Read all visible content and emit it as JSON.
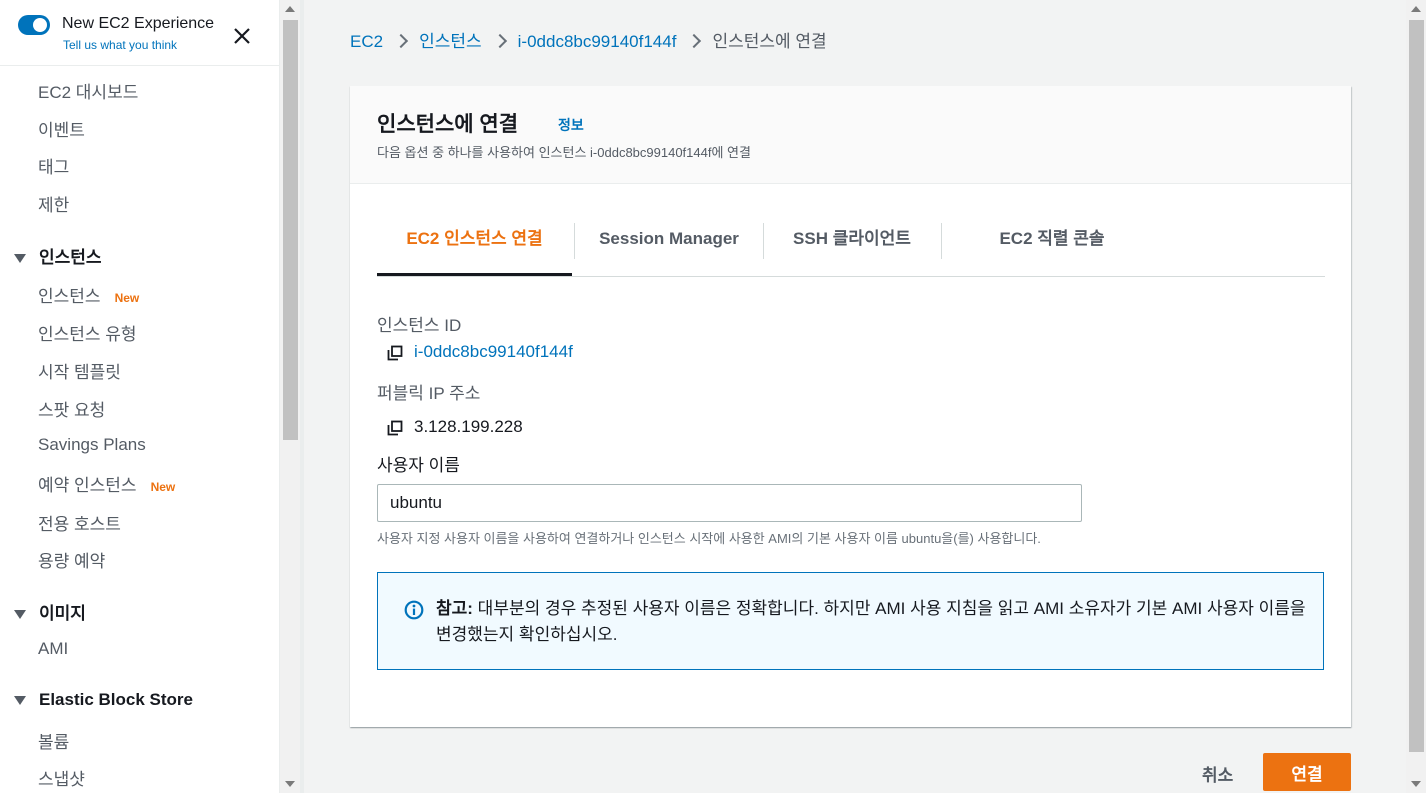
{
  "experience": {
    "title": "New EC2 Experience",
    "link": "Tell us what you think"
  },
  "sidebar": {
    "items_top": [
      "EC2 대시보드",
      "이벤트",
      "태그",
      "제한"
    ],
    "section_instances": "인스턴스",
    "instances_items": [
      {
        "label": "인스턴스",
        "badge": "New"
      },
      {
        "label": "인스턴스 유형",
        "badge": ""
      },
      {
        "label": "시작 템플릿",
        "badge": ""
      },
      {
        "label": "스팟 요청",
        "badge": ""
      },
      {
        "label": "Savings Plans",
        "badge": ""
      },
      {
        "label": "예약 인스턴스",
        "badge": "New"
      },
      {
        "label": "전용 호스트",
        "badge": ""
      },
      {
        "label": "용량 예약",
        "badge": ""
      }
    ],
    "section_images": "이미지",
    "images_items": [
      "AMI"
    ],
    "section_ebs": "Elastic Block Store",
    "ebs_items": [
      "볼륨",
      "스냅샷"
    ]
  },
  "breadcrumb": {
    "ec2": "EC2",
    "instances": "인스턴스",
    "instance_id": "i-0ddc8bc99140f144f",
    "current": "인스턴스에 연결"
  },
  "card": {
    "title": "인스턴스에 연결",
    "info": "정보",
    "description": "다음 옵션 중 하나를 사용하여 인스턴스 i-0ddc8bc99140f144f에 연결"
  },
  "tabs": [
    {
      "label": "EC2 인스턴스 연결",
      "active": true
    },
    {
      "label": "Session Manager",
      "active": false
    },
    {
      "label": "SSH 클라이언트",
      "active": false
    },
    {
      "label": "EC2 직렬 콘솔",
      "active": false
    }
  ],
  "fields": {
    "instance_id_label": "인스턴스 ID",
    "instance_id_value": "i-0ddc8bc99140f144f",
    "public_ip_label": "퍼블릭 IP 주소",
    "public_ip_value": "3.128.199.228",
    "username_label": "사용자 이름",
    "username_value": "ubuntu",
    "username_hint": "사용자 지정 사용자 이름을 사용하여 연결하거나 인스턴스 시작에 사용한 AMI의 기본 사용자 이름 ubuntu을(를) 사용합니다."
  },
  "alert": {
    "prefix": "참고:",
    "text": " 대부분의 경우 추정된 사용자 이름은 정확합니다. 하지만 AMI 사용 지침을 읽고 AMI 소유자가 기본 AMI 사용자 이름을 변경했는지 확인하십시오."
  },
  "buttons": {
    "cancel": "취소",
    "connect": "연결"
  },
  "colors": {
    "link": "#0073bb",
    "accent": "#ec7211",
    "text": "#16191f",
    "secondary_text": "#545b64"
  }
}
